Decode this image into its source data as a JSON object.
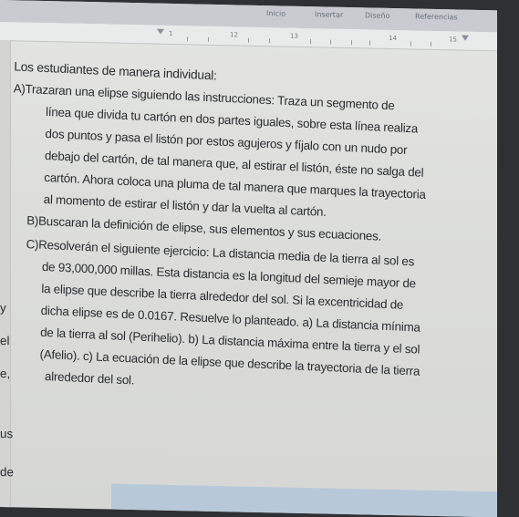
{
  "ribbon": {
    "items": [
      "Inicio",
      "Insertar",
      "Diseño",
      "Referencias"
    ]
  },
  "ruler": {
    "numbers": [
      "1",
      "12",
      "13",
      "14",
      "15"
    ]
  },
  "document": {
    "heading": "Los estudiantes de manera individual:",
    "item_a": {
      "label": "A)",
      "lines": [
        "Trazaran una elipse siguiendo las instrucciones: Traza un segmento de",
        "línea que divida tu cartón en dos partes iguales, sobre esta línea realiza",
        "dos puntos y pasa el listón por estos agujeros y fíjalo con un nudo por",
        "debajo del cartón, de tal manera que, al estirar el listón, éste no salga del",
        "cartón. Ahora coloca una pluma de tal manera que marques la trayectoria",
        "al momento de estirar el listón y dar la vuelta al cartón."
      ]
    },
    "item_b": {
      "label": "B)",
      "text": "Buscaran la definición de elipse, sus elementos y sus ecuaciones."
    },
    "item_c": {
      "label": "C)",
      "lines": [
        "Resolverán el siguiente ejercicio: La distancia media de la tierra al sol es",
        "de 93,000,000 millas. Esta distancia es la longitud del semieje mayor de",
        "la elipse que describe la tierra alrededor del sol. Si la excentricidad de",
        "dicha elipse es de 0.0167. Resuelve lo planteado. a) La distancia mínima",
        "de la tierra al sol (Perihelio). b) La distancia máxima entre la tierra y el sol",
        "(Afelio). c) La ecuación de la elipse que describe la trayectoria de la tierra",
        "alrededor del sol."
      ]
    },
    "left_clipped": [
      "y",
      "el",
      "e,",
      "us",
      "de"
    ]
  }
}
